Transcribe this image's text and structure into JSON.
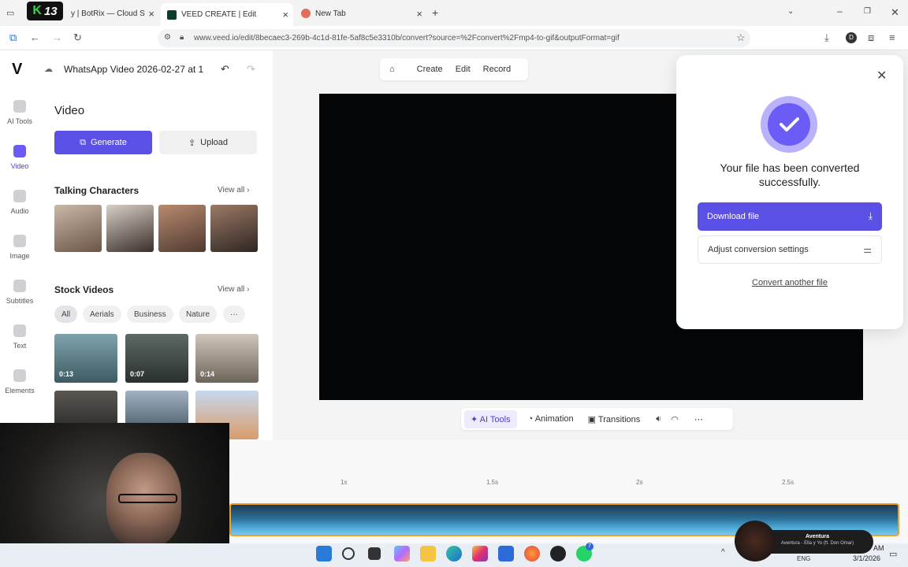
{
  "browser": {
    "tabs": [
      {
        "label": "y | BotRix — Cloud Stream",
        "active": false
      },
      {
        "label": "VEED CREATE | Edit",
        "active": true
      },
      {
        "label": "New Tab",
        "active": false
      }
    ],
    "overlay_badge": "13",
    "url": "www.veed.io/edit/8becaec3-269b-4c1d-81fe-5af8c5e3310b/convert?source=%2Fconvert%2Fmp4-to-gif&outputFormat=gif",
    "profile_initial": "D"
  },
  "header": {
    "project_title": "WhatsApp Video 2026-02-27 at 1",
    "menu": [
      "Create",
      "Edit",
      "Record"
    ]
  },
  "left_rail": [
    {
      "label": "AI Tools"
    },
    {
      "label": "Video",
      "active": true
    },
    {
      "label": "Audio"
    },
    {
      "label": "Image"
    },
    {
      "label": "Subtitles"
    },
    {
      "label": "Text"
    },
    {
      "label": "Elements"
    }
  ],
  "panel": {
    "title": "Video",
    "generate_label": "Generate",
    "upload_label": "Upload",
    "talking_title": "Talking Characters",
    "talking_viewall": "View all",
    "stock_title": "Stock Videos",
    "stock_viewall": "View all",
    "chips": [
      "All",
      "Aerials",
      "Business",
      "Nature",
      "···"
    ],
    "thumbs": [
      {
        "duration": "0:13",
        "color": "#5c7f86"
      },
      {
        "duration": "0:07",
        "color": "#3f4a45"
      },
      {
        "duration": "0:14",
        "color": "#9a8f84"
      },
      {
        "duration": "",
        "color": "#3c3a38"
      },
      {
        "duration": "",
        "color": "#6f7f8f"
      },
      {
        "duration": "",
        "color": "#8aa3c4"
      }
    ]
  },
  "bottom_tools": {
    "ai_tools": "AI Tools",
    "animation": "Animation",
    "transitions": "Transitions"
  },
  "timeline": {
    "ruler": [
      "1s",
      "1.5s",
      "2s",
      "2.5s"
    ]
  },
  "modal": {
    "title": "Your file has been converted successfully.",
    "download_label": "Download file",
    "adjust_label": "Adjust conversion settings",
    "convert_another": "Convert another file"
  },
  "taskbar": {
    "song_title": "Aventura",
    "song_artist": "Aventura - Ella y Yo (ft. Don Omar)",
    "lang": "ENG",
    "time": "AM",
    "date": "3/1/2026",
    "badge_count": "7"
  },
  "colors": {
    "accent": "#5b50e6",
    "accent_light": "#b9b2fb",
    "timeline_border": "#f0a020"
  }
}
